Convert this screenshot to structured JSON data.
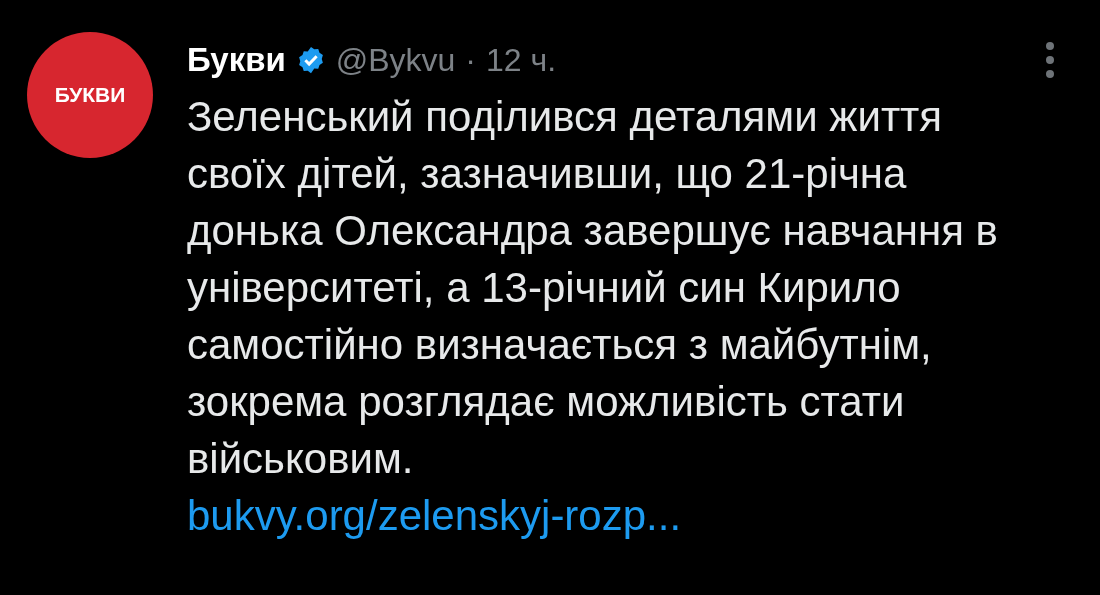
{
  "post": {
    "avatar_text": "БУКВИ",
    "author": "Букви",
    "verified": true,
    "handle": "@Bykvu",
    "separator": "·",
    "time": "12 ч.",
    "text": "Зеленський поділився деталями життя своїх дітей, зазначивши, що 21-річна донька Олександра завершує навчання в університеті, а 13-річний син Кирило самостійно визначається з майбутнім, зокрема розглядає можливість стати військовим.",
    "link": "bukvy.org/zelenskyj-rozp..."
  }
}
